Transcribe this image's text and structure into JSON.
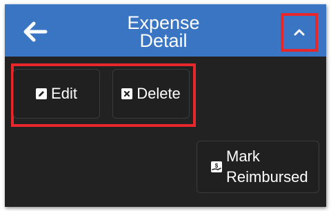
{
  "header": {
    "title_line1": "Expense",
    "title_line2": "Detail",
    "back_icon": "arrow-left-icon",
    "collapse_icon": "chevron-up-icon"
  },
  "actions": {
    "edit_label": "Edit",
    "delete_label": "Delete",
    "reimburse_line1": "Mark",
    "reimburse_line2": "Reimbursed"
  },
  "colors": {
    "header": "#3a75c4",
    "background": "#222222",
    "highlight": "#e8272d"
  }
}
